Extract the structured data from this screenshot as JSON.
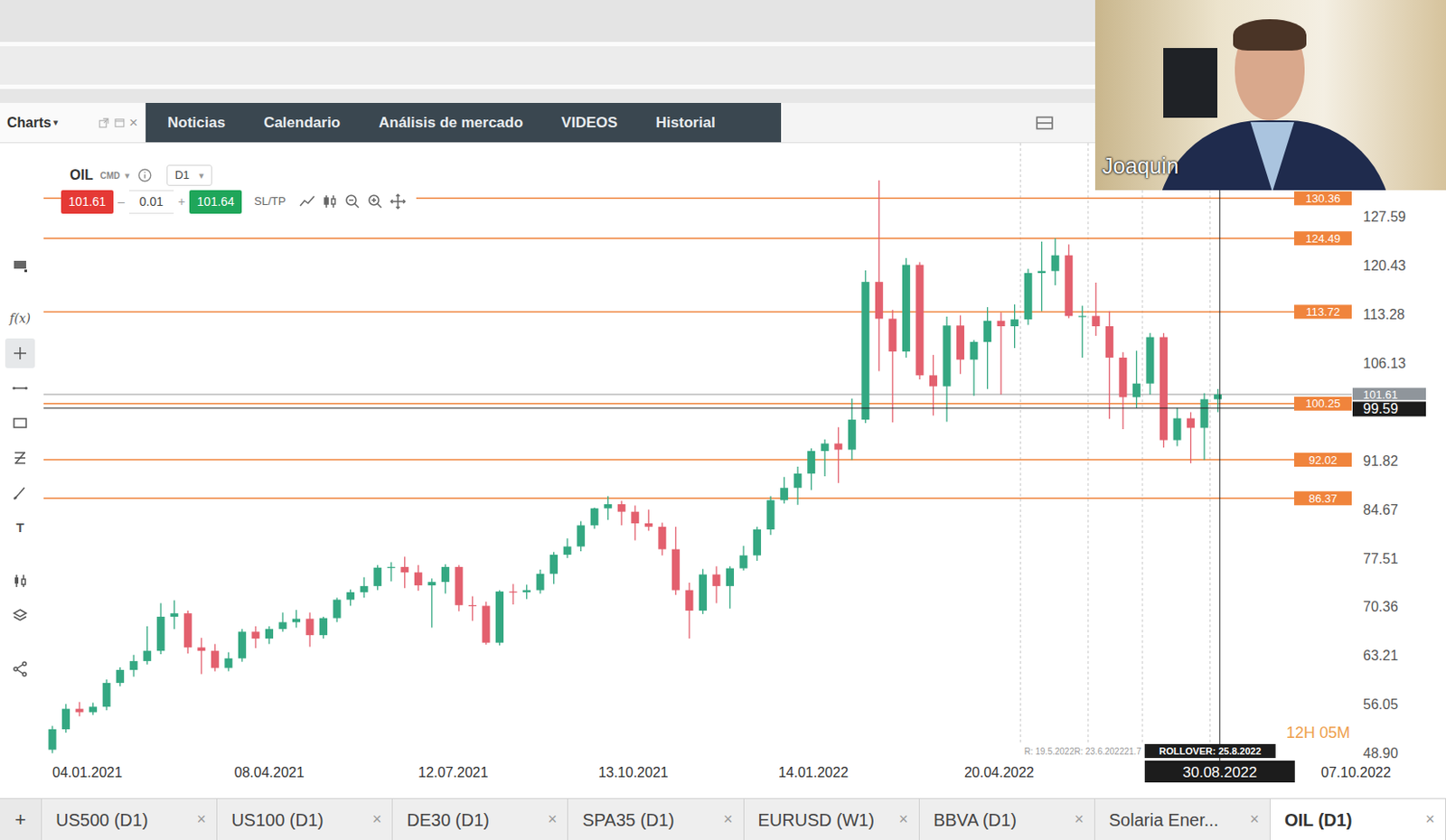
{
  "top_bar": {
    "charts": {
      "label": "Charts",
      "caret": "▾",
      "close": "×"
    },
    "items": [
      {
        "label": "Noticias"
      },
      {
        "label": "Calendario"
      },
      {
        "label": "Análisis de mercado"
      },
      {
        "label": "VIDEOS"
      },
      {
        "label": "Historial"
      }
    ]
  },
  "video": {
    "name": "Joaquin"
  },
  "left_tools": [
    {
      "selected": false
    },
    {
      "label": "f(x)",
      "selected": false
    },
    {
      "selected": true
    },
    {
      "selected": false
    },
    {
      "selected": false
    },
    {
      "selected": false
    },
    {
      "selected": false
    },
    {
      "label": "T",
      "selected": false
    },
    {
      "selected": false
    },
    {
      "selected": false
    },
    {
      "selected": false
    }
  ],
  "chart": {
    "symbol": "OIL",
    "type": "CMD",
    "type_caret": "▾",
    "timeframe": "D1",
    "timeframe_caret": "▾",
    "sell": "101.61",
    "minus": "–",
    "volume": "0.01",
    "plus": "+",
    "buy": "101.64",
    "sltp": "SL/TP",
    "price_ticks": [
      "127.59",
      "120.43",
      "113.28",
      "106.13",
      "91.82",
      "84.67",
      "77.51",
      "70.36",
      "63.21",
      "56.05",
      "48.90"
    ],
    "date_ticks": [
      "04.01.2021",
      "08.04.2021",
      "12.07.2021",
      "13.10.2021",
      "14.01.2022",
      "20.04.2022",
      "07.10.2022"
    ],
    "levels": [
      {
        "label": "130.36"
      },
      {
        "label": "124.49"
      },
      {
        "label": "113.72"
      },
      {
        "label": "100.25"
      },
      {
        "label": "92.02"
      },
      {
        "label": "86.37"
      }
    ],
    "bid": "101.61",
    "crosshair": {
      "price": "99.59",
      "date": "30.08.2022"
    },
    "rollover_dates": [
      "19.5.2022",
      "23.6.2022",
      "21.7.2022",
      "25.8.2022"
    ],
    "rollover_history": "R: 19.5.2022R: 23.6.202221.7",
    "rollover": "ROLLOVER: 25.8.2022",
    "countdown": "12H 05M",
    "candles": [
      [
        49.5,
        53.0,
        49.0,
        52.5
      ],
      [
        52.5,
        56.2,
        52.0,
        55.5
      ],
      [
        55.5,
        56.5,
        54.4,
        55.0
      ],
      [
        55.0,
        56.4,
        54.6,
        55.8
      ],
      [
        55.8,
        59.8,
        55.3,
        59.3
      ],
      [
        59.3,
        61.6,
        58.8,
        61.2
      ],
      [
        61.2,
        63.4,
        60.2,
        62.5
      ],
      [
        62.5,
        67.6,
        62.0,
        64.0
      ],
      [
        64.0,
        71.0,
        63.5,
        69.0
      ],
      [
        69.0,
        71.4,
        67.2,
        69.5
      ],
      [
        69.5,
        69.9,
        63.6,
        64.5
      ],
      [
        64.5,
        65.9,
        60.6,
        64.0
      ],
      [
        64.0,
        65.0,
        61.0,
        61.5
      ],
      [
        61.5,
        63.8,
        61.0,
        62.9
      ],
      [
        62.9,
        67.2,
        62.4,
        66.8
      ],
      [
        66.8,
        67.6,
        64.4,
        65.8
      ],
      [
        65.8,
        67.6,
        65.0,
        67.2
      ],
      [
        67.2,
        69.6,
        66.8,
        68.2
      ],
      [
        68.2,
        70.0,
        67.4,
        68.7
      ],
      [
        68.7,
        69.6,
        64.6,
        66.3
      ],
      [
        66.3,
        69.0,
        65.8,
        68.8
      ],
      [
        68.8,
        71.8,
        68.2,
        71.5
      ],
      [
        71.5,
        73.0,
        70.6,
        72.6
      ],
      [
        72.6,
        74.8,
        71.8,
        73.5
      ],
      [
        73.5,
        76.6,
        72.9,
        76.2
      ],
      [
        76.2,
        77.0,
        74.2,
        76.3
      ],
      [
        76.3,
        77.8,
        73.2,
        75.5
      ],
      [
        75.5,
        76.6,
        72.8,
        73.6
      ],
      [
        73.6,
        74.6,
        67.4,
        74.1
      ],
      [
        74.1,
        76.7,
        72.4,
        76.3
      ],
      [
        76.3,
        76.6,
        69.8,
        70.7
      ],
      [
        70.7,
        72.0,
        68.4,
        70.6
      ],
      [
        70.6,
        71.2,
        64.9,
        65.2
      ],
      [
        65.2,
        72.9,
        64.8,
        72.7
      ],
      [
        72.7,
        73.8,
        70.8,
        72.6
      ],
      [
        72.6,
        73.7,
        71.6,
        72.9
      ],
      [
        72.9,
        75.9,
        72.4,
        75.3
      ],
      [
        75.3,
        78.5,
        73.8,
        78.1
      ],
      [
        78.1,
        80.5,
        77.6,
        79.3
      ],
      [
        79.3,
        83.0,
        78.6,
        82.4
      ],
      [
        82.4,
        85.0,
        81.9,
        84.9
      ],
      [
        84.9,
        86.7,
        83.2,
        85.5
      ],
      [
        85.5,
        86.0,
        82.4,
        84.4
      ],
      [
        84.4,
        85.3,
        80.2,
        82.7
      ],
      [
        82.7,
        84.7,
        81.6,
        82.2
      ],
      [
        82.2,
        82.8,
        78.0,
        78.9
      ],
      [
        78.9,
        82.2,
        72.2,
        72.9
      ],
      [
        72.9,
        74.0,
        65.8,
        69.9
      ],
      [
        69.9,
        76.0,
        69.4,
        75.2
      ],
      [
        75.2,
        76.4,
        71.0,
        73.5
      ],
      [
        73.5,
        76.4,
        70.2,
        76.1
      ],
      [
        76.1,
        79.4,
        75.8,
        78.0
      ],
      [
        78.0,
        82.2,
        77.2,
        81.8
      ],
      [
        81.8,
        86.7,
        81.0,
        86.1
      ],
      [
        86.1,
        89.5,
        85.6,
        87.9
      ],
      [
        87.9,
        91.0,
        85.4,
        90.0
      ],
      [
        90.0,
        93.7,
        87.6,
        93.3
      ],
      [
        93.3,
        95.0,
        89.6,
        94.4
      ],
      [
        94.4,
        96.8,
        88.6,
        93.5
      ],
      [
        93.5,
        101.0,
        92.0,
        97.9
      ],
      [
        97.9,
        119.8,
        97.4,
        118.1
      ],
      [
        118.1,
        133.0,
        105.0,
        112.7
      ],
      [
        112.7,
        114.0,
        97.5,
        107.9
      ],
      [
        107.9,
        121.6,
        107.0,
        120.6
      ],
      [
        120.6,
        121.0,
        103.8,
        104.4
      ],
      [
        104.4,
        107.4,
        98.5,
        102.8
      ],
      [
        102.8,
        113.0,
        97.6,
        111.7
      ],
      [
        111.7,
        113.2,
        104.6,
        106.7
      ],
      [
        106.7,
        109.6,
        101.4,
        109.3
      ],
      [
        109.3,
        114.4,
        102.4,
        112.4
      ],
      [
        112.4,
        113.6,
        101.6,
        111.6
      ],
      [
        111.6,
        114.8,
        108.4,
        112.6
      ],
      [
        112.6,
        120.0,
        111.8,
        119.4
      ],
      [
        119.4,
        124.0,
        113.8,
        119.7
      ],
      [
        119.7,
        124.5,
        117.6,
        122.0
      ],
      [
        122.0,
        123.6,
        112.8,
        113.1
      ],
      [
        113.1,
        114.6,
        107.0,
        113.1
      ],
      [
        113.1,
        118.0,
        110.2,
        111.6
      ],
      [
        111.6,
        113.8,
        98.0,
        107.0
      ],
      [
        107.0,
        107.8,
        96.5,
        101.2
      ],
      [
        101.2,
        108.0,
        99.6,
        103.2
      ],
      [
        103.2,
        110.6,
        101.6,
        110.0
      ],
      [
        110.0,
        110.6,
        93.8,
        94.9
      ],
      [
        94.9,
        99.6,
        94.0,
        98.1
      ],
      [
        98.1,
        99.0,
        91.5,
        96.7
      ],
      [
        96.7,
        101.8,
        92.0,
        100.9
      ],
      [
        100.9,
        102.4,
        99.0,
        101.6
      ]
    ]
  },
  "bottom_tabs": {
    "add": "+",
    "items": [
      {
        "label": "US500 (D1)",
        "close": "×",
        "selected": false
      },
      {
        "label": "US100 (D1)",
        "close": "×",
        "selected": false
      },
      {
        "label": "DE30 (D1)",
        "close": "×",
        "selected": false
      },
      {
        "label": "SPA35 (D1)",
        "close": "×",
        "selected": false
      },
      {
        "label": "EURUSD (W1)",
        "close": "×",
        "selected": false
      },
      {
        "label": "BBVA (D1)",
        "close": "×",
        "selected": false
      },
      {
        "label": "Solaria Ener...",
        "close": "×",
        "selected": false
      },
      {
        "label": "OIL (D1)",
        "close": "×",
        "selected": true
      }
    ]
  }
}
